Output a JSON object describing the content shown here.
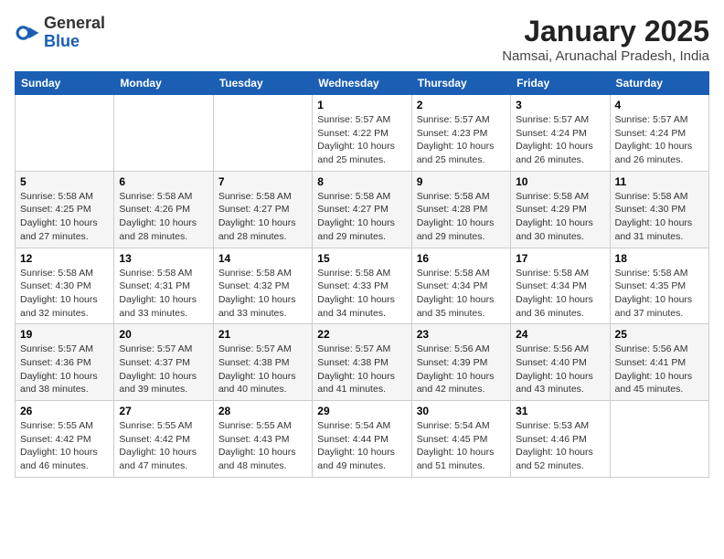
{
  "header": {
    "logo_general": "General",
    "logo_blue": "Blue",
    "title": "January 2025",
    "subtitle": "Namsai, Arunachal Pradesh, India"
  },
  "days_of_week": [
    "Sunday",
    "Monday",
    "Tuesday",
    "Wednesday",
    "Thursday",
    "Friday",
    "Saturday"
  ],
  "weeks": [
    [
      {
        "day": null,
        "sunrise": null,
        "sunset": null,
        "daylight": null
      },
      {
        "day": null,
        "sunrise": null,
        "sunset": null,
        "daylight": null
      },
      {
        "day": null,
        "sunrise": null,
        "sunset": null,
        "daylight": null
      },
      {
        "day": "1",
        "sunrise": "5:57 AM",
        "sunset": "4:22 PM",
        "daylight": "10 hours and 25 minutes."
      },
      {
        "day": "2",
        "sunrise": "5:57 AM",
        "sunset": "4:23 PM",
        "daylight": "10 hours and 25 minutes."
      },
      {
        "day": "3",
        "sunrise": "5:57 AM",
        "sunset": "4:24 PM",
        "daylight": "10 hours and 26 minutes."
      },
      {
        "day": "4",
        "sunrise": "5:57 AM",
        "sunset": "4:24 PM",
        "daylight": "10 hours and 26 minutes."
      }
    ],
    [
      {
        "day": "5",
        "sunrise": "5:58 AM",
        "sunset": "4:25 PM",
        "daylight": "10 hours and 27 minutes."
      },
      {
        "day": "6",
        "sunrise": "5:58 AM",
        "sunset": "4:26 PM",
        "daylight": "10 hours and 28 minutes."
      },
      {
        "day": "7",
        "sunrise": "5:58 AM",
        "sunset": "4:27 PM",
        "daylight": "10 hours and 28 minutes."
      },
      {
        "day": "8",
        "sunrise": "5:58 AM",
        "sunset": "4:27 PM",
        "daylight": "10 hours and 29 minutes."
      },
      {
        "day": "9",
        "sunrise": "5:58 AM",
        "sunset": "4:28 PM",
        "daylight": "10 hours and 29 minutes."
      },
      {
        "day": "10",
        "sunrise": "5:58 AM",
        "sunset": "4:29 PM",
        "daylight": "10 hours and 30 minutes."
      },
      {
        "day": "11",
        "sunrise": "5:58 AM",
        "sunset": "4:30 PM",
        "daylight": "10 hours and 31 minutes."
      }
    ],
    [
      {
        "day": "12",
        "sunrise": "5:58 AM",
        "sunset": "4:30 PM",
        "daylight": "10 hours and 32 minutes."
      },
      {
        "day": "13",
        "sunrise": "5:58 AM",
        "sunset": "4:31 PM",
        "daylight": "10 hours and 33 minutes."
      },
      {
        "day": "14",
        "sunrise": "5:58 AM",
        "sunset": "4:32 PM",
        "daylight": "10 hours and 33 minutes."
      },
      {
        "day": "15",
        "sunrise": "5:58 AM",
        "sunset": "4:33 PM",
        "daylight": "10 hours and 34 minutes."
      },
      {
        "day": "16",
        "sunrise": "5:58 AM",
        "sunset": "4:34 PM",
        "daylight": "10 hours and 35 minutes."
      },
      {
        "day": "17",
        "sunrise": "5:58 AM",
        "sunset": "4:34 PM",
        "daylight": "10 hours and 36 minutes."
      },
      {
        "day": "18",
        "sunrise": "5:58 AM",
        "sunset": "4:35 PM",
        "daylight": "10 hours and 37 minutes."
      }
    ],
    [
      {
        "day": "19",
        "sunrise": "5:57 AM",
        "sunset": "4:36 PM",
        "daylight": "10 hours and 38 minutes."
      },
      {
        "day": "20",
        "sunrise": "5:57 AM",
        "sunset": "4:37 PM",
        "daylight": "10 hours and 39 minutes."
      },
      {
        "day": "21",
        "sunrise": "5:57 AM",
        "sunset": "4:38 PM",
        "daylight": "10 hours and 40 minutes."
      },
      {
        "day": "22",
        "sunrise": "5:57 AM",
        "sunset": "4:38 PM",
        "daylight": "10 hours and 41 minutes."
      },
      {
        "day": "23",
        "sunrise": "5:56 AM",
        "sunset": "4:39 PM",
        "daylight": "10 hours and 42 minutes."
      },
      {
        "day": "24",
        "sunrise": "5:56 AM",
        "sunset": "4:40 PM",
        "daylight": "10 hours and 43 minutes."
      },
      {
        "day": "25",
        "sunrise": "5:56 AM",
        "sunset": "4:41 PM",
        "daylight": "10 hours and 45 minutes."
      }
    ],
    [
      {
        "day": "26",
        "sunrise": "5:55 AM",
        "sunset": "4:42 PM",
        "daylight": "10 hours and 46 minutes."
      },
      {
        "day": "27",
        "sunrise": "5:55 AM",
        "sunset": "4:42 PM",
        "daylight": "10 hours and 47 minutes."
      },
      {
        "day": "28",
        "sunrise": "5:55 AM",
        "sunset": "4:43 PM",
        "daylight": "10 hours and 48 minutes."
      },
      {
        "day": "29",
        "sunrise": "5:54 AM",
        "sunset": "4:44 PM",
        "daylight": "10 hours and 49 minutes."
      },
      {
        "day": "30",
        "sunrise": "5:54 AM",
        "sunset": "4:45 PM",
        "daylight": "10 hours and 51 minutes."
      },
      {
        "day": "31",
        "sunrise": "5:53 AM",
        "sunset": "4:46 PM",
        "daylight": "10 hours and 52 minutes."
      },
      {
        "day": null,
        "sunrise": null,
        "sunset": null,
        "daylight": null
      }
    ]
  ]
}
